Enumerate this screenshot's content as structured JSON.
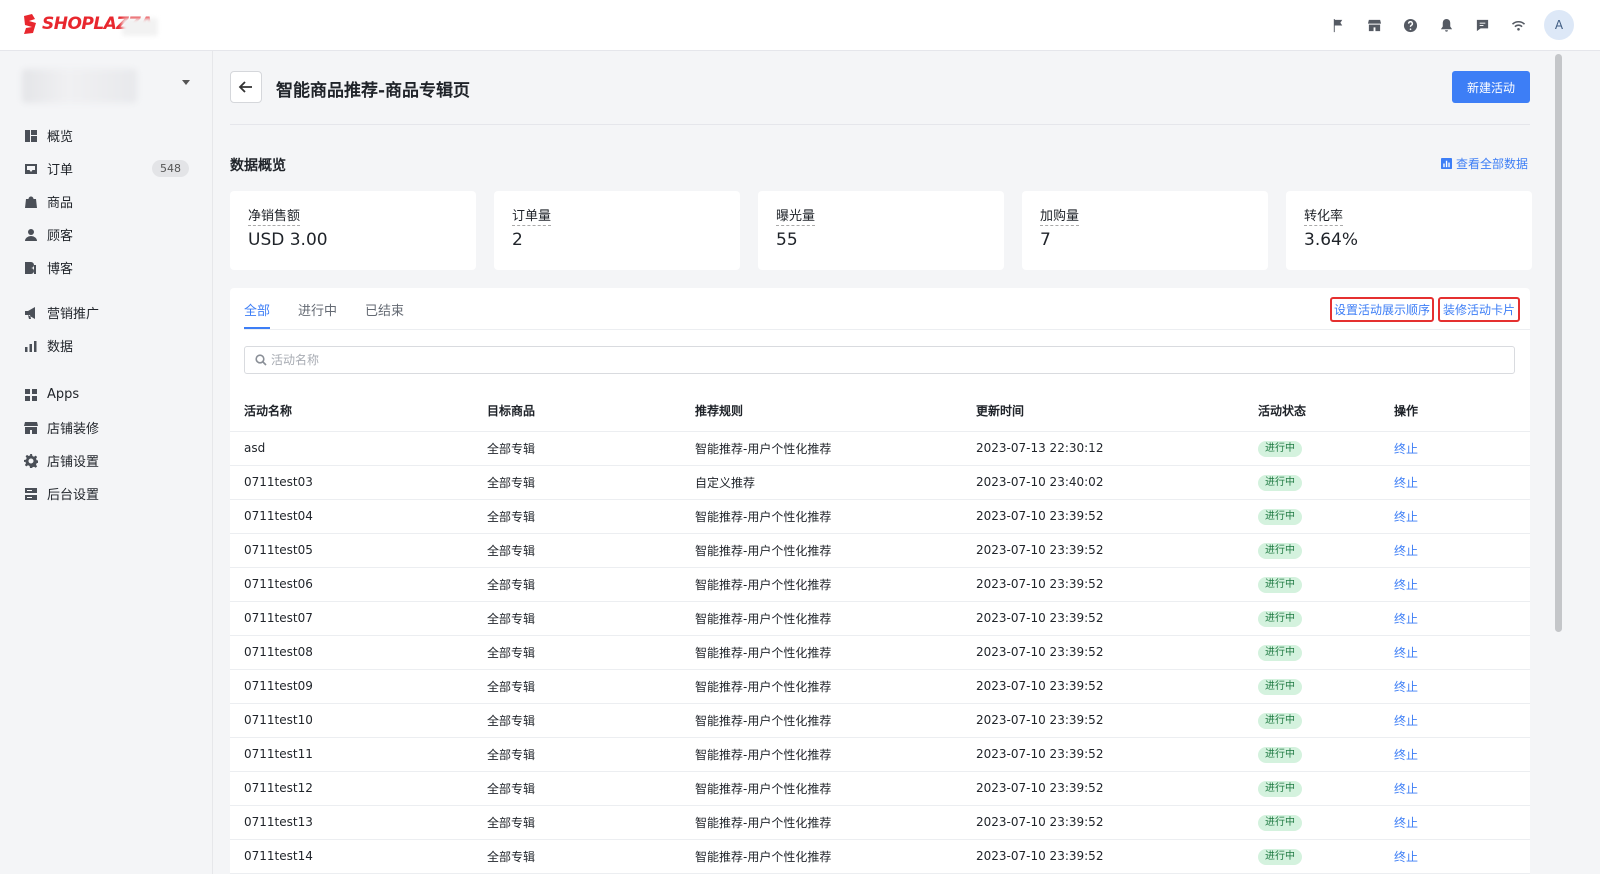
{
  "brand": {
    "name": "SHOPLAZZA",
    "color": "#e8272e"
  },
  "topbar": {
    "icons": [
      "flag-icon",
      "store-icon",
      "help-icon",
      "bell-icon",
      "message-icon",
      "wifi-icon"
    ],
    "avatar_initial": "A"
  },
  "sidebar": {
    "items": [
      {
        "label": "概览",
        "icon": "dashboard-icon"
      },
      {
        "label": "订单",
        "icon": "inbox-icon",
        "badge": "548"
      },
      {
        "label": "商品",
        "icon": "bag-icon"
      },
      {
        "label": "顾客",
        "icon": "user-icon"
      },
      {
        "label": "博客",
        "icon": "blog-icon"
      },
      {
        "label": "营销推广",
        "icon": "megaphone-icon"
      },
      {
        "label": "数据",
        "icon": "bar-chart-icon"
      },
      {
        "label": "Apps",
        "icon": "apps-icon"
      },
      {
        "label": "店铺装修",
        "icon": "store-icon"
      },
      {
        "label": "店铺设置",
        "icon": "gear-icon"
      },
      {
        "label": "后台设置",
        "icon": "server-icon"
      }
    ]
  },
  "header": {
    "title": "智能商品推荐-商品专辑页",
    "new_button": "新建活动"
  },
  "overview": {
    "title": "数据概览",
    "view_all": "查看全部数据",
    "stats": [
      {
        "label": "净销售额",
        "value": "USD 3.00"
      },
      {
        "label": "订单量",
        "value": "2"
      },
      {
        "label": "曝光量",
        "value": "55"
      },
      {
        "label": "加购量",
        "value": "7"
      },
      {
        "label": "转化率",
        "value": "3.64%"
      }
    ]
  },
  "tabs": [
    {
      "label": "全部",
      "active": true
    },
    {
      "label": "进行中",
      "active": false
    },
    {
      "label": "已结束",
      "active": false
    }
  ],
  "actions": {
    "set_order": "设置活动展示顺序",
    "decorate_card": "装修活动卡片"
  },
  "search": {
    "placeholder": "活动名称"
  },
  "table": {
    "columns": [
      "活动名称",
      "目标商品",
      "推荐规则",
      "更新时间",
      "活动状态",
      "操作"
    ],
    "rows": [
      {
        "name": "asd",
        "target": "全部专辑",
        "rule": "智能推荐-用户个性化推荐",
        "updated": "2023-07-13 22:30:12",
        "status": "进行中",
        "action": "终止"
      },
      {
        "name": "0711test03",
        "target": "全部专辑",
        "rule": "自定义推荐",
        "updated": "2023-07-10 23:40:02",
        "status": "进行中",
        "action": "终止"
      },
      {
        "name": "0711test04",
        "target": "全部专辑",
        "rule": "智能推荐-用户个性化推荐",
        "updated": "2023-07-10 23:39:52",
        "status": "进行中",
        "action": "终止"
      },
      {
        "name": "0711test05",
        "target": "全部专辑",
        "rule": "智能推荐-用户个性化推荐",
        "updated": "2023-07-10 23:39:52",
        "status": "进行中",
        "action": "终止"
      },
      {
        "name": "0711test06",
        "target": "全部专辑",
        "rule": "智能推荐-用户个性化推荐",
        "updated": "2023-07-10 23:39:52",
        "status": "进行中",
        "action": "终止"
      },
      {
        "name": "0711test07",
        "target": "全部专辑",
        "rule": "智能推荐-用户个性化推荐",
        "updated": "2023-07-10 23:39:52",
        "status": "进行中",
        "action": "终止"
      },
      {
        "name": "0711test08",
        "target": "全部专辑",
        "rule": "智能推荐-用户个性化推荐",
        "updated": "2023-07-10 23:39:52",
        "status": "进行中",
        "action": "终止"
      },
      {
        "name": "0711test09",
        "target": "全部专辑",
        "rule": "智能推荐-用户个性化推荐",
        "updated": "2023-07-10 23:39:52",
        "status": "进行中",
        "action": "终止"
      },
      {
        "name": "0711test10",
        "target": "全部专辑",
        "rule": "智能推荐-用户个性化推荐",
        "updated": "2023-07-10 23:39:52",
        "status": "进行中",
        "action": "终止"
      },
      {
        "name": "0711test11",
        "target": "全部专辑",
        "rule": "智能推荐-用户个性化推荐",
        "updated": "2023-07-10 23:39:52",
        "status": "进行中",
        "action": "终止"
      },
      {
        "name": "0711test12",
        "target": "全部专辑",
        "rule": "智能推荐-用户个性化推荐",
        "updated": "2023-07-10 23:39:52",
        "status": "进行中",
        "action": "终止"
      },
      {
        "name": "0711test13",
        "target": "全部专辑",
        "rule": "智能推荐-用户个性化推荐",
        "updated": "2023-07-10 23:39:52",
        "status": "进行中",
        "action": "终止"
      },
      {
        "name": "0711test14",
        "target": "全部专辑",
        "rule": "智能推荐-用户个性化推荐",
        "updated": "2023-07-10 23:39:52",
        "status": "进行中",
        "action": "终止"
      }
    ]
  }
}
